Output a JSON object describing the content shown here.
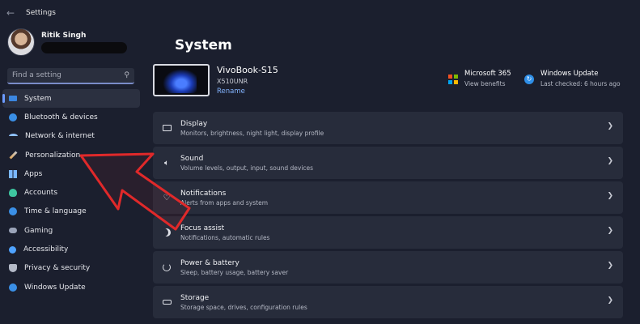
{
  "window": {
    "title": "Settings"
  },
  "user": {
    "name": "Ritik Singh"
  },
  "search": {
    "placeholder": "Find a setting"
  },
  "nav": [
    {
      "label": "System",
      "icon": "system-icon",
      "active": true
    },
    {
      "label": "Bluetooth & devices",
      "icon": "bluetooth-icon"
    },
    {
      "label": "Network & internet",
      "icon": "wifi-icon"
    },
    {
      "label": "Personalization",
      "icon": "brush-icon"
    },
    {
      "label": "Apps",
      "icon": "apps-icon"
    },
    {
      "label": "Accounts",
      "icon": "person-icon"
    },
    {
      "label": "Time & language",
      "icon": "globe-clock-icon"
    },
    {
      "label": "Gaming",
      "icon": "gamepad-icon"
    },
    {
      "label": "Accessibility",
      "icon": "accessibility-icon"
    },
    {
      "label": "Privacy & security",
      "icon": "shield-icon"
    },
    {
      "label": "Windows Update",
      "icon": "update-icon"
    }
  ],
  "main": {
    "title": "System",
    "device": {
      "name": "VivoBook-S15",
      "model": "X510UNR",
      "rename": "Rename"
    },
    "microsoft365": {
      "title": "Microsoft 365",
      "subtitle": "View benefits"
    },
    "windows_update": {
      "title": "Windows Update",
      "subtitle": "Last checked: 6 hours ago"
    },
    "cards": [
      {
        "title": "Display",
        "subtitle": "Monitors, brightness, night light, display profile",
        "icon": "monitor-icon"
      },
      {
        "title": "Sound",
        "subtitle": "Volume levels, output, input, sound devices",
        "icon": "speaker-icon"
      },
      {
        "title": "Notifications",
        "subtitle": "Alerts from apps and system",
        "icon": "bell-icon"
      },
      {
        "title": "Focus assist",
        "subtitle": "Notifications, automatic rules",
        "icon": "moon-icon"
      },
      {
        "title": "Power & battery",
        "subtitle": "Sleep, battery usage, battery saver",
        "icon": "power-icon"
      },
      {
        "title": "Storage",
        "subtitle": "Storage space, drives, configuration rules",
        "icon": "storage-icon"
      }
    ]
  },
  "colors": {
    "accent": "#6c9bff",
    "annotation": "#e0292a"
  }
}
